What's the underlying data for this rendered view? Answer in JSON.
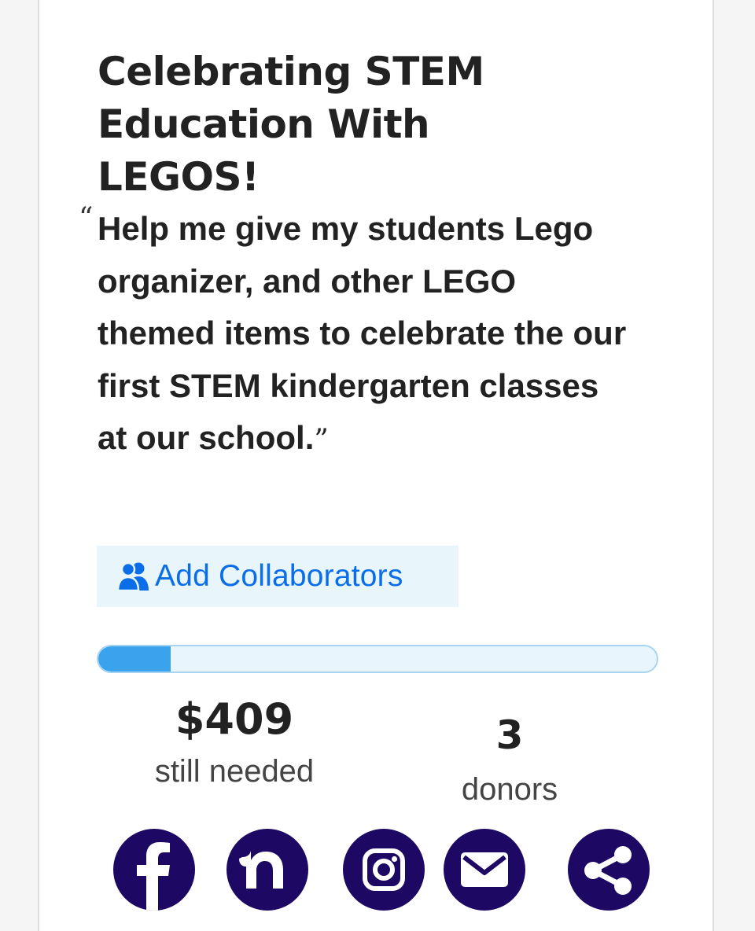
{
  "project": {
    "title": "Celebrating STEM Education With LEGOS!",
    "quote_open": "“",
    "quote": "Help me give my students Lego organizer, and other LEGO themed items to celebrate the our first STEM kindergarten classes at our school.",
    "quote_close": "”"
  },
  "collaborators": {
    "label": "Add Collaborators",
    "icon": "users-icon"
  },
  "progress": {
    "funded_fraction": 0.13
  },
  "stats": {
    "amount_needed": "$409",
    "amount_label": "still needed",
    "donors_count": "3",
    "donors_label": "donors"
  },
  "share": {
    "buttons": [
      {
        "name": "facebook",
        "icon": "facebook-icon"
      },
      {
        "name": "nextdoor",
        "icon": "nextdoor-icon"
      },
      {
        "name": "instagram",
        "icon": "instagram-icon"
      },
      {
        "name": "email",
        "icon": "envelope-icon"
      },
      {
        "name": "share",
        "icon": "share-icon"
      }
    ]
  },
  "colors": {
    "brand_dark": "#1d0863",
    "link_blue": "#0b6ee8",
    "progress_fill": "#3aa3ee",
    "progress_track": "#e9f5fd",
    "collab_bg": "#e8f6fb"
  }
}
